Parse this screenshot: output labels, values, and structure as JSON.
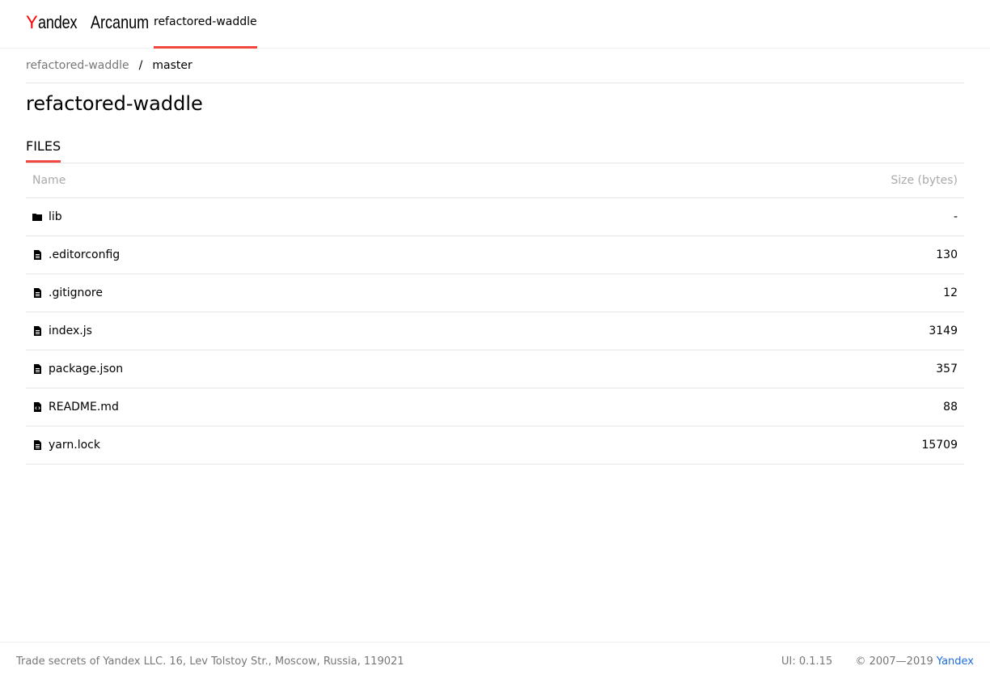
{
  "header": {
    "logo_y": "Y",
    "logo_rest": "andex",
    "logo_product": "Arcanum",
    "nav_tab": "refactored-waddle"
  },
  "breadcrumb": {
    "root": "refactored-waddle",
    "separator": "/",
    "current": "master"
  },
  "page": {
    "title": "refactored-waddle"
  },
  "tabs": {
    "files": "FILES"
  },
  "table": {
    "columns": {
      "name": "Name",
      "size": "Size (bytes)"
    },
    "rows": [
      {
        "icon": "folder-icon",
        "name": "lib",
        "size": "-"
      },
      {
        "icon": "file-icon",
        "name": ".editorconfig",
        "size": "130"
      },
      {
        "icon": "file-icon",
        "name": ".gitignore",
        "size": "12"
      },
      {
        "icon": "file-icon",
        "name": "index.js",
        "size": "3149"
      },
      {
        "icon": "file-icon",
        "name": "package.json",
        "size": "357"
      },
      {
        "icon": "code-file-icon",
        "name": "README.md",
        "size": "88"
      },
      {
        "icon": "file-icon",
        "name": "yarn.lock",
        "size": "15709"
      }
    ]
  },
  "footer": {
    "trade_secrets": "Trade secrets of Yandex LLC. 16, Lev Tolstoy Str., Moscow, Russia, 119021",
    "ui_version": "UI: 0.1.15",
    "copyright": "© 2007—2019",
    "yandex_link": "Yandex"
  },
  "colors": {
    "accent": "#f2473f",
    "link": "#1e6de0",
    "logo_red": "#ff0000"
  }
}
